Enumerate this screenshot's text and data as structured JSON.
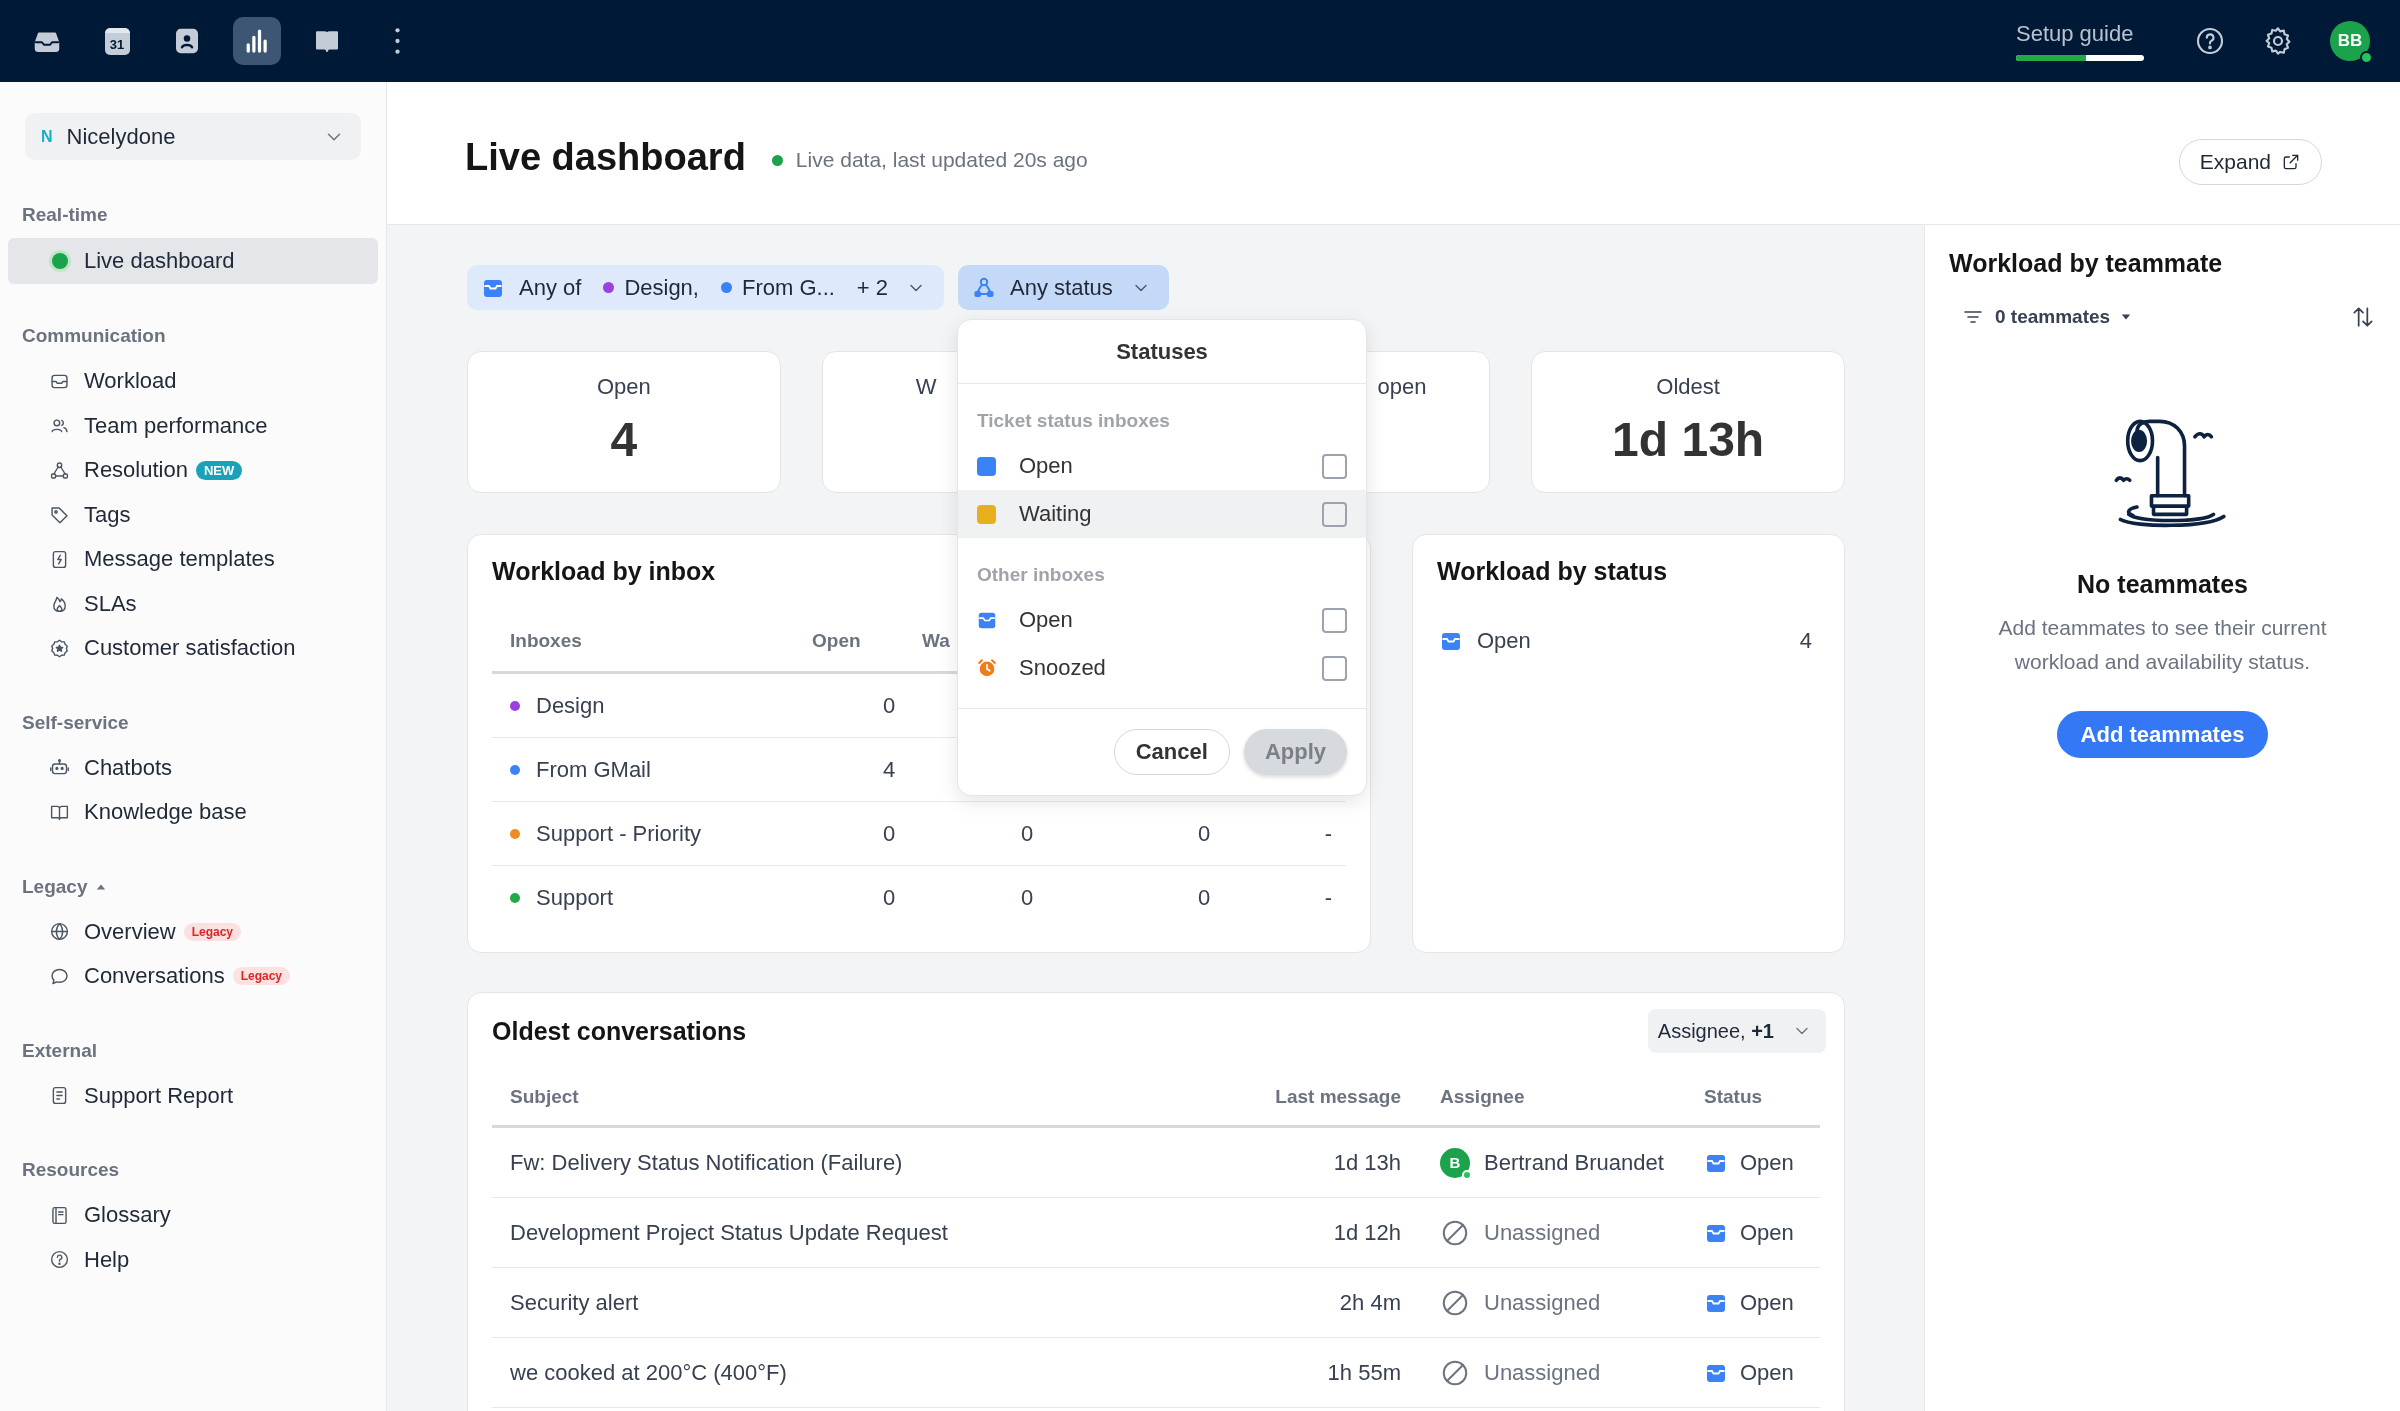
{
  "top_nav": {
    "apps": [
      {
        "selected": false
      },
      {
        "selected": false,
        "label": "31"
      },
      {
        "selected": false
      },
      {
        "selected": true
      },
      {
        "selected": false
      },
      {
        "selected": false
      }
    ],
    "setup_guide": {
      "label": "Setup guide",
      "level": 0.55
    },
    "avatar": {
      "initials": "BB",
      "online": true
    }
  },
  "sidebar": {
    "workspace": {
      "initial": "N",
      "name": "Nicelydone"
    },
    "sections": [
      {
        "title": "Real-time",
        "items": [
          {
            "label": "Live dashboard",
            "selected": true
          }
        ]
      },
      {
        "title": "Communication",
        "items": [
          {
            "label": "Workload",
            "selected": false
          },
          {
            "label": "Team performance",
            "selected": false
          },
          {
            "label": "Resolution",
            "selected": false,
            "badge": {
              "text": "NEW",
              "kind": "new"
            }
          },
          {
            "label": "Tags",
            "selected": false
          },
          {
            "label": "Message templates",
            "selected": false
          },
          {
            "label": "SLAs",
            "selected": false
          },
          {
            "label": "Customer satisfaction",
            "selected": false
          }
        ]
      },
      {
        "title": "Self-service",
        "items": [
          {
            "label": "Chatbots",
            "selected": false
          },
          {
            "label": "Knowledge base",
            "selected": false
          }
        ]
      },
      {
        "title": "Legacy",
        "expanded": true,
        "items": [
          {
            "label": "Overview",
            "selected": false,
            "badge": {
              "text": "Legacy",
              "kind": "legacy"
            }
          },
          {
            "label": "Conversations",
            "selected": false,
            "badge": {
              "text": "Legacy",
              "kind": "legacy"
            }
          }
        ]
      },
      {
        "title": "External",
        "items": [
          {
            "label": "Support Report",
            "selected": false
          }
        ]
      },
      {
        "title": "Resources",
        "items": [
          {
            "label": "Glossary",
            "selected": false
          },
          {
            "label": "Help",
            "selected": false
          }
        ]
      }
    ]
  },
  "header": {
    "title": "Live dashboard",
    "live": true,
    "status": "Live data, last updated 20s ago",
    "expand_button": "Expand"
  },
  "filters": [
    {
      "kind": "inbox",
      "prefix": "Any of",
      "chips": [
        {
          "label": "Design,",
          "color": "#9b3fe0"
        },
        {
          "label": "From G...",
          "color": "#3b82f6"
        }
      ],
      "more": "+ 2",
      "expanded": false
    },
    {
      "kind": "status",
      "label": "Any status",
      "expanded": true
    }
  ],
  "stats": [
    {
      "label": "Open",
      "value": "4"
    },
    {
      "label": "W"
    },
    {
      "label": "open"
    },
    {
      "label": "Oldest",
      "value": "1d 13h"
    }
  ],
  "status_menu": {
    "title": "Statuses",
    "groups": [
      {
        "label": "Ticket status inboxes",
        "options": [
          {
            "label": "Open",
            "kind": "square",
            "color": "#3b82f6",
            "checked": false,
            "highlighted": false
          },
          {
            "label": "Waiting",
            "kind": "square",
            "color": "#e5b01c",
            "checked": false,
            "highlighted": true
          }
        ]
      },
      {
        "label": "Other inboxes",
        "options": [
          {
            "label": "Open",
            "kind": "inbox",
            "checked": false,
            "highlighted": false
          },
          {
            "label": "Snoozed",
            "kind": "clock",
            "checked": false,
            "highlighted": false
          }
        ]
      }
    ],
    "buttons": [
      {
        "label": "Cancel",
        "kind": "secondary",
        "disabled": false
      },
      {
        "label": "Apply",
        "kind": "primary",
        "disabled": true
      }
    ]
  },
  "workload_by_inbox": {
    "title": "Workload by inbox",
    "columns": [
      "Inboxes",
      "Open",
      "Wa"
    ],
    "rows": [
      {
        "name": "Design",
        "color": "#9b3fe0",
        "cells": [
          "0"
        ]
      },
      {
        "name": "From GMail",
        "color": "#3b82f6",
        "cells": [
          "4"
        ]
      },
      {
        "name": "Support - Priority",
        "color": "#f08a24",
        "cells": [
          "0",
          "0",
          "0",
          "-"
        ]
      },
      {
        "name": "Support",
        "color": "#22a845",
        "cells": [
          "0",
          "0",
          "0",
          "-"
        ]
      }
    ]
  },
  "workload_by_status": {
    "title": "Workload by status",
    "rows": [
      {
        "label": "Open",
        "count": "4"
      }
    ]
  },
  "oldest_conversations": {
    "title": "Oldest conversations",
    "filter": "Assignee, **+1**",
    "columns": [
      "Subject",
      "Last message",
      "Assignee",
      "Status"
    ],
    "rows": [
      {
        "subject": "Fw: Delivery Status Notification (Failure)",
        "last_message": "1d 13h",
        "assignee": {
          "kind": "user",
          "initial": "B",
          "name": "Bertrand Bruandet"
        },
        "status": "Open"
      },
      {
        "subject": "Development Project Status Update Request",
        "last_message": "1d 12h",
        "assignee": {
          "kind": "unassigned",
          "name": "Unassigned"
        },
        "status": "Open"
      },
      {
        "subject": "Security alert",
        "last_message": "2h 4m",
        "assignee": {
          "kind": "unassigned",
          "name": "Unassigned"
        },
        "status": "Open"
      },
      {
        "subject": "we cooked at 200°C (400°F)",
        "last_message": "1h 55m",
        "assignee": {
          "kind": "unassigned",
          "name": "Unassigned"
        },
        "status": "Open"
      }
    ]
  },
  "workload_by_teammate": {
    "title": "Workload by teammate",
    "filter": "0 teammates",
    "empty_title": "No teammates",
    "empty_text": "Add teammates to see their current workload and availability status.",
    "button": "Add teammates"
  }
}
